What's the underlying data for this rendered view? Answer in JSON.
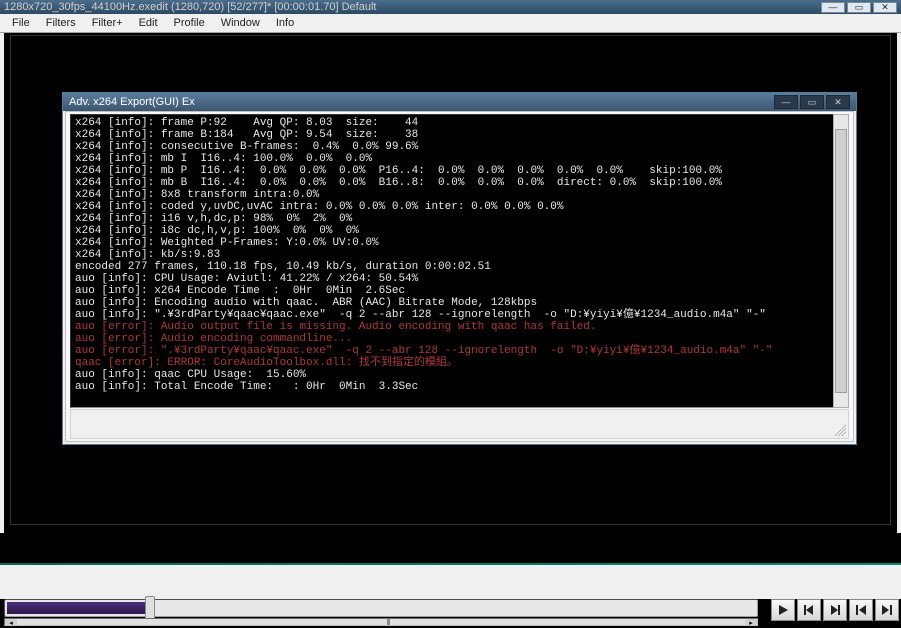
{
  "main": {
    "title": "1280x720_30fps_44100Hz.exedit (1280,720)  [52/277]* [00:00:01.70]  Default"
  },
  "menu": {
    "items": [
      "File",
      "Filters",
      "Filter+",
      "Edit",
      "Profile",
      "Window",
      "Info"
    ]
  },
  "dialog": {
    "title": "Adv. x264 Export(GUI) Ex",
    "console_lines": [
      {
        "t": "info",
        "text": "x264 [info]: frame P:92    Avg QP: 8.03  size:    44"
      },
      {
        "t": "info",
        "text": "x264 [info]: frame B:184   Avg QP: 9.54  size:    38"
      },
      {
        "t": "info",
        "text": "x264 [info]: consecutive B-frames:  0.4%  0.0% 99.6%"
      },
      {
        "t": "info",
        "text": "x264 [info]: mb I  I16..4: 100.0%  0.0%  0.0%"
      },
      {
        "t": "info",
        "text": "x264 [info]: mb P  I16..4:  0.0%  0.0%  0.0%  P16..4:  0.0%  0.0%  0.0%  0.0%  0.0%    skip:100.0%"
      },
      {
        "t": "info",
        "text": "x264 [info]: mb B  I16..4:  0.0%  0.0%  0.0%  B16..8:  0.0%  0.0%  0.0%  direct: 0.0%  skip:100.0%"
      },
      {
        "t": "info",
        "text": "x264 [info]: 8x8 transform intra:0.0%"
      },
      {
        "t": "info",
        "text": "x264 [info]: coded y,uvDC,uvAC intra: 0.0% 0.0% 0.0% inter: 0.0% 0.0% 0.0%"
      },
      {
        "t": "info",
        "text": "x264 [info]: i16 v,h,dc,p: 98%  0%  2%  0%"
      },
      {
        "t": "info",
        "text": "x264 [info]: i8c dc,h,v,p: 100%  0%  0%  0%"
      },
      {
        "t": "info",
        "text": "x264 [info]: Weighted P-Frames: Y:0.0% UV:0.0%"
      },
      {
        "t": "info",
        "text": "x264 [info]: kb/s:9.83"
      },
      {
        "t": "info",
        "text": ""
      },
      {
        "t": "info",
        "text": "encoded 277 frames, 110.18 fps, 10.49 kb/s, duration 0:00:02.51"
      },
      {
        "t": "info",
        "text": "auo [info]: CPU Usage: Aviutl: 41.22% / x264: 50.54%"
      },
      {
        "t": "info",
        "text": "auo [info]: x264 Encode Time  :  0Hr  0Min  2.6Sec"
      },
      {
        "t": "info",
        "text": "auo [info]: Encoding audio with qaac.  ABR (AAC) Bitrate Mode, 128kbps"
      },
      {
        "t": "info",
        "text": "auo [info]: \".¥3rdParty¥qaac¥qaac.exe\"  -q 2 --abr 128 --ignorelength  -o \"D:¥yiyi¥億¥1234_audio.m4a\" \"-\""
      },
      {
        "t": "err",
        "text": "auo [error]: Audio output file is missing. Audio encoding with qaac has failed."
      },
      {
        "t": "err",
        "text": "auo [error]: Audio encoding commandline..."
      },
      {
        "t": "err",
        "text": "auo [error]: \".¥3rdParty¥qaac¥qaac.exe\"  -q 2 --abr 128 --ignorelength  -o \"D:¥yiyi¥億¥1234_audio.m4a\" \"-\""
      },
      {
        "t": "err",
        "text": "qaac [error]: ERROR: CoreAudioToolbox.dll: 找不到指定的模組。"
      },
      {
        "t": "info",
        "text": "auo [info]: qaac CPU Usage:  15.60%"
      },
      {
        "t": "info",
        "text": "auo [info]: Total Encode Time:   : 0Hr  0Min  3.3Sec"
      }
    ]
  },
  "playback": {
    "buttons": [
      "play",
      "step-back",
      "step-forward",
      "first-frame",
      "last-frame"
    ]
  }
}
